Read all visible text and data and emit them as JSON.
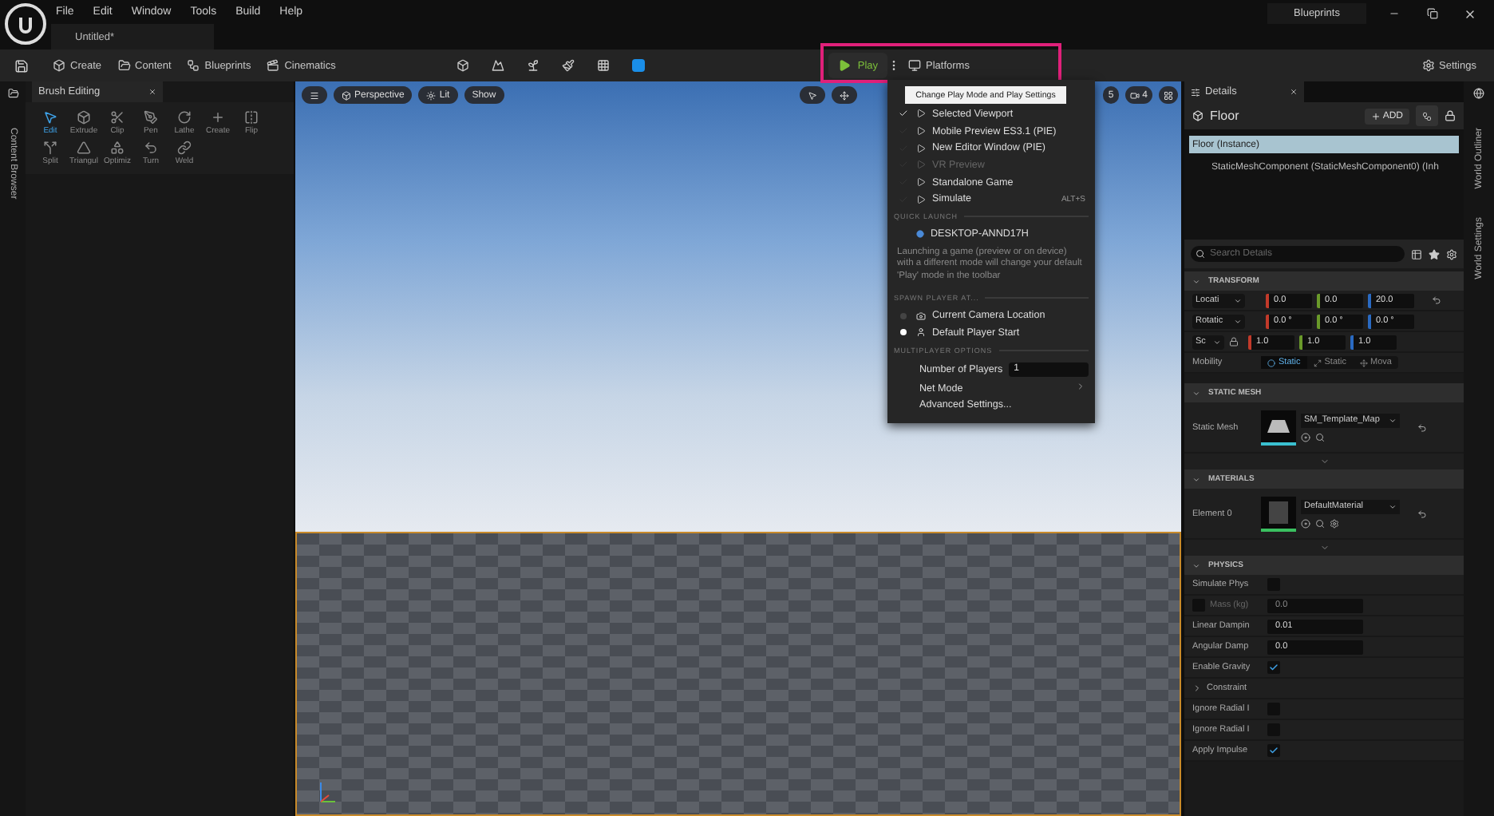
{
  "app_menu": [
    {
      "label": "File"
    },
    {
      "label": "Edit"
    },
    {
      "label": "Window"
    },
    {
      "label": "Tools"
    },
    {
      "label": "Build"
    },
    {
      "label": "Help"
    }
  ],
  "title_tab": {
    "label": "Blueprints"
  },
  "document_tab": {
    "label": "Untitled*"
  },
  "toolbar": {
    "menus": [
      {
        "label": "Create"
      },
      {
        "label": "Content"
      },
      {
        "label": "Blueprints"
      },
      {
        "label": "Cinematics"
      }
    ],
    "play": "Play",
    "platforms": "Platforms",
    "settings": "Settings"
  },
  "left_sidebar": {
    "label": "Content Browser"
  },
  "brush_panel": {
    "title": "Brush Editing",
    "tools": [
      {
        "label": "Edit",
        "selected": true
      },
      {
        "label": "Extrude",
        "selected": false
      },
      {
        "label": "Clip",
        "selected": false
      },
      {
        "label": "Pen",
        "selected": false
      },
      {
        "label": "Lathe",
        "selected": false
      },
      {
        "label": "Create",
        "selected": false
      },
      {
        "label": "Flip",
        "selected": false
      },
      {
        "label": "Split",
        "selected": false
      },
      {
        "label": "Triangul",
        "selected": false
      },
      {
        "label": "Optimiz",
        "selected": false
      },
      {
        "label": "Turn",
        "selected": false
      },
      {
        "label": "Weld",
        "selected": false
      }
    ]
  },
  "viewport": {
    "view": "Perspective",
    "lighting": "Lit",
    "show": "Show",
    "snap": "5",
    "camera_speed": "4"
  },
  "play_menu": {
    "tooltip": "Change Play Mode and Play Settings",
    "modes": [
      {
        "label": "Selected Viewport",
        "selected": true,
        "disabled": false
      },
      {
        "label": "Mobile Preview ES3.1 (PIE)",
        "selected": false,
        "disabled": false
      },
      {
        "label": "New Editor Window (PIE)",
        "selected": false,
        "disabled": false
      },
      {
        "label": "VR Preview",
        "selected": false,
        "disabled": true
      },
      {
        "label": "Standalone Game",
        "selected": false,
        "disabled": false
      },
      {
        "label": "Simulate",
        "selected": false,
        "disabled": false,
        "shortcut": "ALT+S"
      }
    ],
    "quick_launch": {
      "heading": "QUICK LAUNCH",
      "device": "DESKTOP-ANND17H",
      "note": "Launching a game (preview or on device) with a different mode will change your default 'Play' mode in the toolbar"
    },
    "spawn": {
      "heading": "SPAWN PLAYER AT...",
      "options": [
        {
          "label": "Current Camera Location",
          "selected": false
        },
        {
          "label": "Default Player Start",
          "selected": true
        }
      ]
    },
    "multiplayer": {
      "heading": "MULTIPLAYER OPTIONS",
      "players_label": "Number of Players",
      "players": "1",
      "net_mode": "Net Mode",
      "advanced": "Advanced Settings..."
    }
  },
  "details": {
    "tab": "Details",
    "actor": "Floor",
    "add": "ADD",
    "tree": [
      {
        "label": "Floor (Instance)",
        "selected": true
      },
      {
        "label": "StaticMeshComponent (StaticMeshComponent0) (Inh",
        "selected": false
      }
    ],
    "search_placeholder": "Search Details",
    "transform": {
      "heading": "TRANSFORM",
      "rows": [
        {
          "label": "Locati",
          "values": [
            "0.0",
            "0.0",
            "20.0"
          ],
          "lock": false
        },
        {
          "label": "Rotatic",
          "values": [
            "0.0 °",
            "0.0 °",
            "0.0 °"
          ],
          "lock": false
        },
        {
          "label": "Sc",
          "values": [
            "1.0",
            "1.0",
            "1.0"
          ],
          "lock": true
        }
      ],
      "mobility_label": "Mobility",
      "mobility": [
        {
          "label": "Static",
          "selected": true
        },
        {
          "label": "Static",
          "selected": false
        },
        {
          "label": "Mova",
          "selected": false
        }
      ]
    },
    "static_mesh": {
      "heading": "STATIC MESH",
      "label": "Static Mesh",
      "asset": "SM_Template_Map"
    },
    "materials": {
      "heading": "MATERIALS",
      "label": "Element 0",
      "asset": "DefaultMaterial"
    },
    "physics": {
      "heading": "PHYSICS",
      "rows": [
        {
          "kind": "checkbox",
          "label": "Simulate Phys",
          "checked": false
        },
        {
          "kind": "optional_number",
          "label": "Mass (kg)",
          "value": "0.0",
          "checked": false
        },
        {
          "kind": "number",
          "label": "Linear Dampin",
          "value": "0.01"
        },
        {
          "kind": "number",
          "label": "Angular Damp",
          "value": "0.0"
        },
        {
          "kind": "checkbox",
          "label": "Enable Gravity",
          "checked": true
        },
        {
          "kind": "group",
          "label": "Constraint",
          "expanded": false
        },
        {
          "kind": "checkbox",
          "label": "Ignore Radial I",
          "checked": false
        },
        {
          "kind": "checkbox",
          "label": "Ignore Radial I",
          "checked": false
        },
        {
          "kind": "checkbox",
          "label": "Apply Impulse",
          "checked": true
        }
      ]
    }
  },
  "right_sidebar": [
    {
      "label": "World Outliner"
    },
    {
      "label": "World Settings"
    }
  ]
}
